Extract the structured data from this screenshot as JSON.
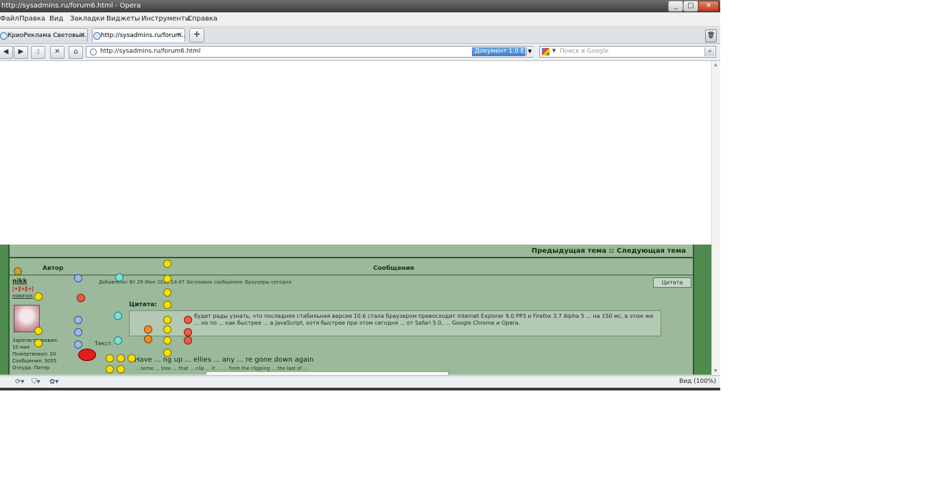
{
  "window": {
    "title": "http://sysadmins.ru/forum6.html - Opera",
    "min_label": "_",
    "max_label": "□",
    "close_label": "✕"
  },
  "menu": {
    "items": [
      "Файл",
      "Правка",
      "Вид",
      "Закладки",
      "Виджеты",
      "Инструменты",
      "Справка"
    ]
  },
  "tabs": [
    {
      "label": "КриоРеклама Световые...",
      "close": "✕"
    },
    {
      "label": "http://sysadmins.ru/forum...",
      "close": "✕"
    }
  ],
  "newtab_label": "+",
  "trash_label": "🗑",
  "nav": {
    "back": "◀",
    "forward": "▶",
    "key": "⚷",
    "stop": "✕",
    "home": "⌂",
    "url": "http://sysadmins.ru/forum6.html",
    "doc_label": "Документ 1.0 E",
    "doc_arrow": "▼",
    "search_placeholder": "Поиск в Google",
    "search_dropdown": "▼",
    "search_button": "⌕"
  },
  "forum": {
    "nav_links": "Предыдущая тема :: Следующая тема",
    "col_author": "Автор",
    "col_message": "Сообщение",
    "author_name": "nikk",
    "rank": "[+][+][+]",
    "author_status": "новичок",
    "author_info": [
      "Зарегистрирован:",
      "10 мая",
      "Пожертвовал: 20",
      "Сообщения: 3055",
      "Откуда: Питер"
    ],
    "post_meta": "Добавлено: Вт 29 Июн 2010 14:47    Заголовок сообщения: Браузеры сегодня",
    "quote_button": "Цитата",
    "quote_label": "Цитата:",
    "quote_text": "будет рады узнать, что последняя стабильная версия 10.6 стала браузером превосходит Internet Explorer 9.0 PP3 и Firefox 3.7 Alpha 5 ... на 150 мс, в этом же ... но по ... как быстрее ... в JavaScript, хотя быстрее при этом сегодня ... от Safari 5.0, ... Google Chrome и Opera.",
    "post_text": "Текст:",
    "post_line2": "Have  ... ng up  ... ellies  ... any ... re gone down again",
    "post_line3": "... some ... tree ... that  ...  clip ... it  ... ...  from the clipping ... the last of ..."
  },
  "status": {
    "zoom": "Вид (100%)"
  },
  "icons": [
    "window-min-icon",
    "window-max-icon",
    "window-close-icon",
    "tab-page-icon",
    "trash-icon",
    "back-icon",
    "forward-icon",
    "key-icon",
    "stop-icon",
    "home-icon",
    "page-info-icon",
    "google-icon",
    "search-icon",
    "smiley-icon",
    "zoom-icon"
  ],
  "colors": {
    "forum_bg": "#4f8a4f",
    "post_bg": "#9cb99c",
    "accent_blue": "#3f7fc9"
  }
}
